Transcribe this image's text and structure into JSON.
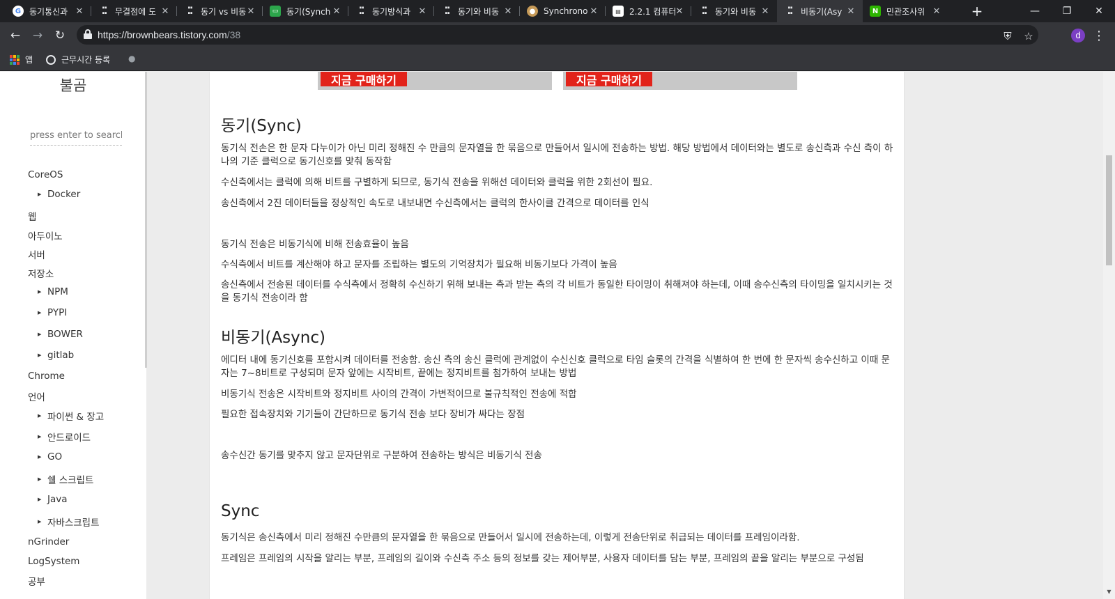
{
  "browser": {
    "tabs": [
      {
        "title": "동기통신과",
        "favicon": "google-g-icon"
      },
      {
        "title": "무결점에 도",
        "favicon": "tistory-t-icon"
      },
      {
        "title": "동기 vs 비동",
        "favicon": "tistory-t-icon"
      },
      {
        "title": "동기(Synch",
        "favicon": "chat-icon"
      },
      {
        "title": "동기방식과",
        "favicon": "tistory-t-icon"
      },
      {
        "title": "동기와 비동",
        "favicon": "tistory-t-icon"
      },
      {
        "title": "Synchrono",
        "favicon": "avatar-icon"
      },
      {
        "title": "2.2.1 컴퓨터",
        "favicon": "document-icon"
      },
      {
        "title": "동기와 비동",
        "favicon": "tistory-t-icon"
      },
      {
        "title": "비동기(Asy",
        "favicon": "tistory-t-icon",
        "active": true
      },
      {
        "title": "민관조사위",
        "favicon": "naver-n-icon"
      }
    ],
    "new_tab": "+",
    "window_controls": {
      "minimize": "—",
      "restore": "❐",
      "close": "✕"
    },
    "url_host": "https://brownbears.tistory.com",
    "url_path": "/38",
    "profile_initial": "d",
    "bookmarks": {
      "apps_label": "앱",
      "item_label": "근무시간 등록"
    }
  },
  "sidebar": {
    "blog_title": "불곰",
    "search_placeholder": "press enter to search",
    "categories": [
      {
        "label": "CoreOS"
      },
      {
        "label": "Docker",
        "sub": true
      },
      {
        "label": "웹"
      },
      {
        "label": "아두이노"
      },
      {
        "label": "서버"
      },
      {
        "label": "저장소"
      },
      {
        "label": "NPM",
        "sub": true
      },
      {
        "label": "PYPI",
        "sub": true
      },
      {
        "label": "BOWER",
        "sub": true
      },
      {
        "label": "gitlab",
        "sub": true
      },
      {
        "label": "Chrome"
      },
      {
        "label": "언어"
      },
      {
        "label": "파이썬 & 장고",
        "sub": true
      },
      {
        "label": "안드로이드",
        "sub": true
      },
      {
        "label": "GO",
        "sub": true
      },
      {
        "label": "쉘 스크립트",
        "sub": true
      },
      {
        "label": "Java",
        "sub": true
      },
      {
        "label": "자바스크립트",
        "sub": true
      },
      {
        "label": "nGrinder"
      },
      {
        "label": "LogSystem"
      },
      {
        "label": "공부"
      }
    ]
  },
  "article": {
    "ad_button_label": "지금 구매하기",
    "sections": [
      {
        "heading": "동기(Sync)",
        "paragraphs": [
          "동기식 전손은 한 문자 다누이가 아닌 미리 정해진 수 만큼의 문자열을 한 묶음으로 만들어서 일시에 전송하는 방법. 해당 방법에서 데이터와는 별도로 송신측과 수신 측이 하나의 기준 클럭으로 동기신호를 맞춰 동작함",
          "수신측에서는 클럭에 의해 비트를 구별하게 되므로, 동기식 전송을 위해선 데이터와 클럭을 위한 2회선이 필요.",
          "송신측에서 2진 데이터들을 정상적인 속도로 내보내면 수신측에서는 클럭의 한사이클 간격으로 데이터를 인식",
          "동기식 전송은 비동기식에 비해 전송효율이 높음",
          "수식측에서 비트를 계산해야 하고 문자를 조립하는 별도의 기억장치가 필요해 비동기보다 가격이 높음",
          "송신측에서 전송된 데이터를 수식측에서 정확히 수신하기 위해 보내는 측과 받는 측의 각 비트가 동일한 타이밍이 취해져야 하는데, 이때 송수신측의 타이밍을 일치시키는 것을 동기식 전송이라 함"
        ]
      },
      {
        "heading": "비동기(Async)",
        "paragraphs": [
          "에디터 내에 동기신호를 포함시켜 데이터를 전송함. 송신 측의 송신 클럭에 관계없이 수신신호 클럭으로 타임 슬롯의 간격을 식별하여 한 번에 한 문자씩 송수신하고 이때 문자는 7~8비트로 구성되며 문자 앞에는 시작비트, 끝에는 정지비트를 첨가하여 보내는 방법",
          "비동기식 전송은 시작비트와 정지비트 사이의 간격이 가변적이므로 불규칙적인 전송에 적합",
          "필요한 접속장치와 기기들이 간단하므로 동기식 전송 보다 장비가 싸다는 장점",
          "송수신간 동기를 맞추지 않고 문자단위로 구분하여 전송하는 방식은 비동기식 전송"
        ]
      },
      {
        "heading": "Sync",
        "paragraphs": [
          "동기식은 송신측에서 미리 정해진 수만큼의 문자열을 한 묶음으로 만들어서 일시에 전송하는데, 이렇게 전송단위로 취급되는 데이터를 프레임이라함.",
          "프레임은 프레임의 시작을 알리는 부분, 프레임의 길이와 수신측 주소 등의 정보를 갖는 제어부분, 사용자 데이터를 담는 부분, 프레임의 끝을 알리는 부분으로 구성됨"
        ]
      }
    ]
  },
  "colors": {
    "tabstrip": "#202124",
    "toolbar": "#35363a",
    "ad_red": "#e2231a",
    "page_bg": "#ececec"
  }
}
